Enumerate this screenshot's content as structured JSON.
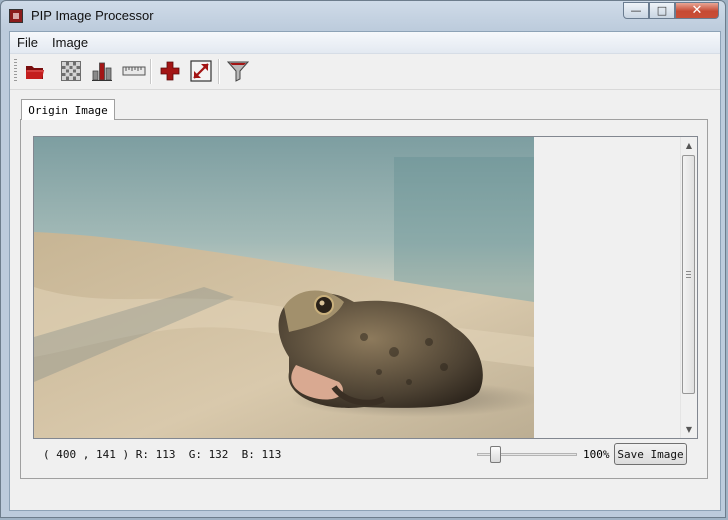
{
  "window": {
    "title": "PIP Image Processor",
    "minimize_glyph": "—",
    "maximize_glyph": "□",
    "close_glyph": "✕"
  },
  "menu": {
    "items": [
      "File",
      "Image"
    ]
  },
  "toolbar": {
    "buttons": [
      {
        "name": "open-folder-icon"
      },
      {
        "name": "mosaic-grid-icon"
      },
      {
        "name": "histogram-icon"
      },
      {
        "name": "ruler-icon"
      },
      {
        "name": "add-icon"
      },
      {
        "name": "resize-icon"
      },
      {
        "name": "filter-icon"
      }
    ]
  },
  "tabs": [
    {
      "label": "Origin Image",
      "active": true
    }
  ],
  "image": {
    "subject": "frog on sand"
  },
  "status": {
    "x": "400",
    "y": "141",
    "r": "113",
    "g": "132",
    "b": "113",
    "text": "( 400 , 141 ) R: 113  G: 132  B: 113"
  },
  "zoom": {
    "label": "100%",
    "slider_fraction": 0.15
  },
  "buttons": {
    "save_image": "Save Image"
  },
  "scrollbar": {
    "up_glyph": "▲",
    "down_glyph": "▼"
  },
  "colors": {
    "accent_red": "#9b1414",
    "close_button": "#c64a33",
    "title_bar": "#cfdbe8"
  }
}
